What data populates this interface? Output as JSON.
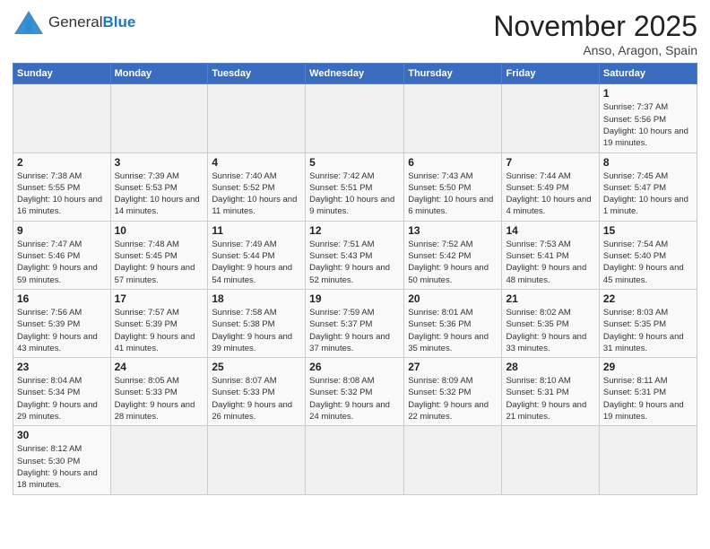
{
  "header": {
    "logo_general": "General",
    "logo_blue": "Blue",
    "month_title": "November 2025",
    "location": "Anso, Aragon, Spain"
  },
  "days_of_week": [
    "Sunday",
    "Monday",
    "Tuesday",
    "Wednesday",
    "Thursday",
    "Friday",
    "Saturday"
  ],
  "weeks": [
    [
      {
        "day": "",
        "info": ""
      },
      {
        "day": "",
        "info": ""
      },
      {
        "day": "",
        "info": ""
      },
      {
        "day": "",
        "info": ""
      },
      {
        "day": "",
        "info": ""
      },
      {
        "day": "",
        "info": ""
      },
      {
        "day": "1",
        "info": "Sunrise: 7:37 AM\nSunset: 5:56 PM\nDaylight: 10 hours\nand 19 minutes."
      }
    ],
    [
      {
        "day": "2",
        "info": "Sunrise: 7:38 AM\nSunset: 5:55 PM\nDaylight: 10 hours\nand 16 minutes."
      },
      {
        "day": "3",
        "info": "Sunrise: 7:39 AM\nSunset: 5:53 PM\nDaylight: 10 hours\nand 14 minutes."
      },
      {
        "day": "4",
        "info": "Sunrise: 7:40 AM\nSunset: 5:52 PM\nDaylight: 10 hours\nand 11 minutes."
      },
      {
        "day": "5",
        "info": "Sunrise: 7:42 AM\nSunset: 5:51 PM\nDaylight: 10 hours\nand 9 minutes."
      },
      {
        "day": "6",
        "info": "Sunrise: 7:43 AM\nSunset: 5:50 PM\nDaylight: 10 hours\nand 6 minutes."
      },
      {
        "day": "7",
        "info": "Sunrise: 7:44 AM\nSunset: 5:49 PM\nDaylight: 10 hours\nand 4 minutes."
      },
      {
        "day": "8",
        "info": "Sunrise: 7:45 AM\nSunset: 5:47 PM\nDaylight: 10 hours\nand 1 minute."
      }
    ],
    [
      {
        "day": "9",
        "info": "Sunrise: 7:47 AM\nSunset: 5:46 PM\nDaylight: 9 hours\nand 59 minutes."
      },
      {
        "day": "10",
        "info": "Sunrise: 7:48 AM\nSunset: 5:45 PM\nDaylight: 9 hours\nand 57 minutes."
      },
      {
        "day": "11",
        "info": "Sunrise: 7:49 AM\nSunset: 5:44 PM\nDaylight: 9 hours\nand 54 minutes."
      },
      {
        "day": "12",
        "info": "Sunrise: 7:51 AM\nSunset: 5:43 PM\nDaylight: 9 hours\nand 52 minutes."
      },
      {
        "day": "13",
        "info": "Sunrise: 7:52 AM\nSunset: 5:42 PM\nDaylight: 9 hours\nand 50 minutes."
      },
      {
        "day": "14",
        "info": "Sunrise: 7:53 AM\nSunset: 5:41 PM\nDaylight: 9 hours\nand 48 minutes."
      },
      {
        "day": "15",
        "info": "Sunrise: 7:54 AM\nSunset: 5:40 PM\nDaylight: 9 hours\nand 45 minutes."
      }
    ],
    [
      {
        "day": "16",
        "info": "Sunrise: 7:56 AM\nSunset: 5:39 PM\nDaylight: 9 hours\nand 43 minutes."
      },
      {
        "day": "17",
        "info": "Sunrise: 7:57 AM\nSunset: 5:39 PM\nDaylight: 9 hours\nand 41 minutes."
      },
      {
        "day": "18",
        "info": "Sunrise: 7:58 AM\nSunset: 5:38 PM\nDaylight: 9 hours\nand 39 minutes."
      },
      {
        "day": "19",
        "info": "Sunrise: 7:59 AM\nSunset: 5:37 PM\nDaylight: 9 hours\nand 37 minutes."
      },
      {
        "day": "20",
        "info": "Sunrise: 8:01 AM\nSunset: 5:36 PM\nDaylight: 9 hours\nand 35 minutes."
      },
      {
        "day": "21",
        "info": "Sunrise: 8:02 AM\nSunset: 5:35 PM\nDaylight: 9 hours\nand 33 minutes."
      },
      {
        "day": "22",
        "info": "Sunrise: 8:03 AM\nSunset: 5:35 PM\nDaylight: 9 hours\nand 31 minutes."
      }
    ],
    [
      {
        "day": "23",
        "info": "Sunrise: 8:04 AM\nSunset: 5:34 PM\nDaylight: 9 hours\nand 29 minutes."
      },
      {
        "day": "24",
        "info": "Sunrise: 8:05 AM\nSunset: 5:33 PM\nDaylight: 9 hours\nand 28 minutes."
      },
      {
        "day": "25",
        "info": "Sunrise: 8:07 AM\nSunset: 5:33 PM\nDaylight: 9 hours\nand 26 minutes."
      },
      {
        "day": "26",
        "info": "Sunrise: 8:08 AM\nSunset: 5:32 PM\nDaylight: 9 hours\nand 24 minutes."
      },
      {
        "day": "27",
        "info": "Sunrise: 8:09 AM\nSunset: 5:32 PM\nDaylight: 9 hours\nand 22 minutes."
      },
      {
        "day": "28",
        "info": "Sunrise: 8:10 AM\nSunset: 5:31 PM\nDaylight: 9 hours\nand 21 minutes."
      },
      {
        "day": "29",
        "info": "Sunrise: 8:11 AM\nSunset: 5:31 PM\nDaylight: 9 hours\nand 19 minutes."
      }
    ],
    [
      {
        "day": "30",
        "info": "Sunrise: 8:12 AM\nSunset: 5:30 PM\nDaylight: 9 hours\nand 18 minutes."
      },
      {
        "day": "",
        "info": ""
      },
      {
        "day": "",
        "info": ""
      },
      {
        "day": "",
        "info": ""
      },
      {
        "day": "",
        "info": ""
      },
      {
        "day": "",
        "info": ""
      },
      {
        "day": "",
        "info": ""
      }
    ]
  ]
}
